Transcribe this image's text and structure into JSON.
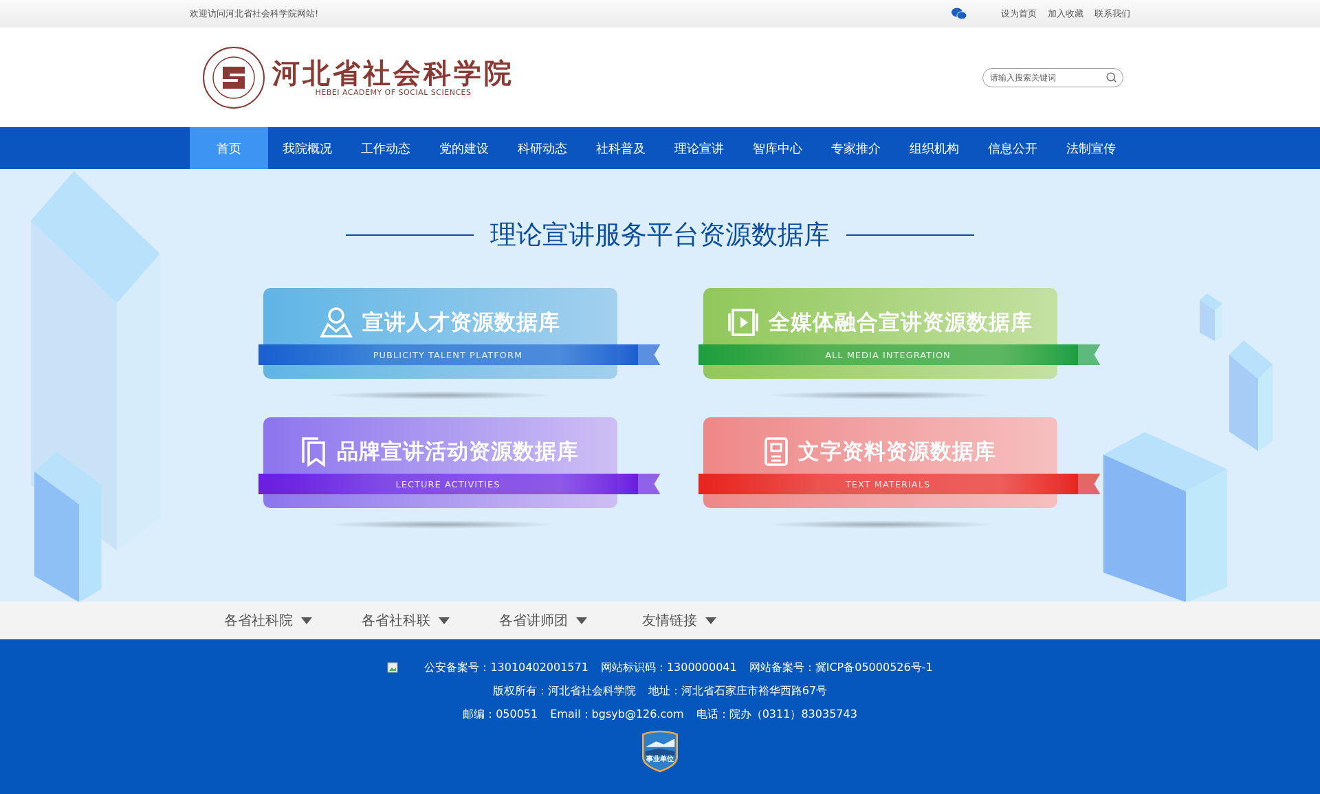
{
  "top_bar": {
    "welcome": "欢迎访问河北省社会科学院网站!",
    "links": [
      "设为首页",
      "加入收藏",
      "联系我们"
    ]
  },
  "header": {
    "logo": {
      "name": "河北省社会科学院",
      "english": "HEBEI ACADEMY OF SOCIAL SCIENCES"
    },
    "search": {
      "placeholder": "请输入搜索关键词"
    }
  },
  "nav": [
    {
      "label": "首页",
      "selected": true
    },
    {
      "label": "我院概况",
      "selected": false
    },
    {
      "label": "工作动态",
      "selected": false
    },
    {
      "label": "党的建设",
      "selected": false
    },
    {
      "label": "科研动态",
      "selected": false
    },
    {
      "label": "社科普及",
      "selected": false
    },
    {
      "label": "理论宣讲",
      "selected": false
    },
    {
      "label": "智库中心",
      "selected": false
    },
    {
      "label": "专家推介",
      "selected": false
    },
    {
      "label": "组织机构",
      "selected": false
    },
    {
      "label": "信息公开",
      "selected": false
    },
    {
      "label": "法制宣传",
      "selected": false
    }
  ],
  "banner": {
    "title": "理论宣讲服务平台资源数据库",
    "cards": [
      {
        "kind": "person",
        "title": "宣讲人才资源数据库",
        "subtitle": "PUBLICITY TALENT PLATFORM",
        "color": "#1a5fd0"
      },
      {
        "kind": "video",
        "title": "全媒体融合宣讲资源数据库",
        "subtitle": "ALL MEDIA INTEGRATION",
        "color": "#1e9e3e"
      },
      {
        "kind": "bookmark",
        "title": "品牌宣讲活动资源数据库",
        "subtitle": "LECTURE ACTIVITIES",
        "color": "#6a1de0"
      },
      {
        "kind": "document",
        "title": "文字资料资源数据库",
        "subtitle": "TEXT MATERIALS",
        "color": "#e8241e"
      }
    ]
  },
  "links_bar": [
    "各省社科院",
    "各省社科联",
    "各省讲师团",
    "友情链接"
  ],
  "footer": {
    "lines": [
      [
        "公安备案号：13010402001571",
        "网站标识码：1300000041",
        "网站备案号：冀ICP备05000526号-1"
      ],
      [
        "版权所有：河北省社会科学院",
        "地址：河北省石家庄市裕华西路67号"
      ],
      [
        "邮编：050051",
        "Email：bgsyb@126.com",
        "电话：院办（0311）83035743"
      ]
    ],
    "badge": "事业单位"
  }
}
